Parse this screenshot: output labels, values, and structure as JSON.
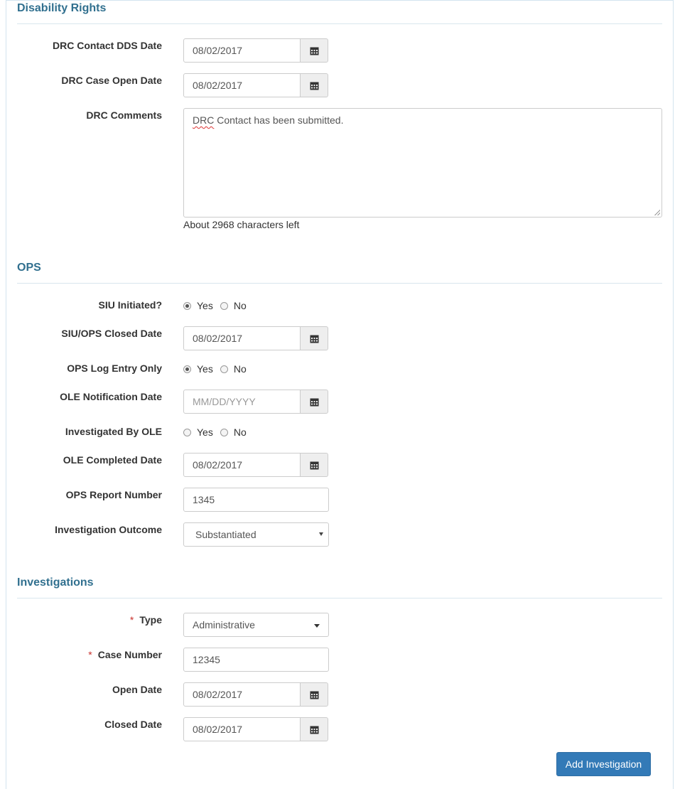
{
  "disability_rights": {
    "title": "Disability Rights",
    "drc_contact_dds_date": {
      "label": "DRC Contact DDS Date",
      "value": "08/02/2017"
    },
    "drc_case_open_date": {
      "label": "DRC Case Open Date",
      "value": "08/02/2017"
    },
    "drc_comments": {
      "label": "DRC Comments",
      "value_misspelled": "DRC",
      "value_rest": " Contact has been submitted.",
      "help": "About 2968 characters left"
    }
  },
  "ops": {
    "title": "OPS",
    "siu_initiated": {
      "label": "SIU Initiated?",
      "yes": "Yes",
      "no": "No",
      "selected": "Yes"
    },
    "siu_ops_closed_date": {
      "label": "SIU/OPS Closed Date",
      "value": "08/02/2017"
    },
    "ops_log_entry_only": {
      "label": "OPS Log Entry Only",
      "yes": "Yes",
      "no": "No",
      "selected": "Yes"
    },
    "ole_notification_date": {
      "label": "OLE Notification Date",
      "placeholder": "MM/DD/YYYY"
    },
    "investigated_by_ole": {
      "label": "Investigated By OLE",
      "yes": "Yes",
      "no": "No",
      "selected": ""
    },
    "ole_completed_date": {
      "label": "OLE Completed Date",
      "value": "08/02/2017"
    },
    "ops_report_number": {
      "label": "OPS Report Number",
      "value": "1345"
    },
    "investigation_outcome": {
      "label": "Investigation Outcome",
      "value": "Substantiated"
    }
  },
  "investigations": {
    "title": "Investigations",
    "type": {
      "required_mark": "*",
      "label": "Type",
      "value": "Administrative"
    },
    "case_number": {
      "required_mark": "*",
      "label": "Case Number",
      "value": "12345"
    },
    "open_date": {
      "label": "Open Date",
      "value": "08/02/2017"
    },
    "closed_date": {
      "label": "Closed Date",
      "value": "08/02/2017"
    },
    "add_button": "Add Investigation"
  },
  "icons": {
    "calendar": "calendar-icon",
    "dropdown": "chevron-down-icon"
  }
}
